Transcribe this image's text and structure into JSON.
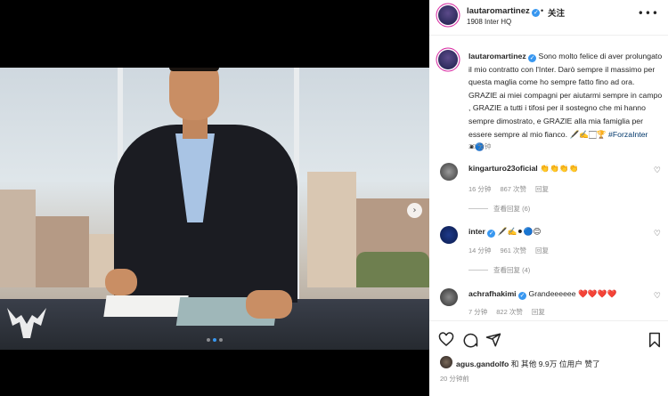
{
  "header": {
    "username": "lautaromartinez",
    "separator": "•",
    "follow_label": "关注",
    "location": "1908 Inter HQ",
    "more_icon": "ellipsis-icon"
  },
  "media": {
    "next_arrow": "›",
    "slide_count": 3,
    "active_slide": 2,
    "logo": "lm-bull-logo"
  },
  "caption": {
    "username": "lautaromartinez",
    "text": "Sono molto felice di aver prolungato il mio contratto con l'Inter. Darò sempre il massimo per questa maglia come ho sempre fatto fino ad ora. GRAZIE ai miei compagni per aiutarmi sempre in campo , GRAZIE a tutti i tifosi per il sostegno che mi hanno sempre dimostrato, e GRAZIE alla mia famiglia per essere sempre al mio fianco. 🖋️✍️🏻🏆",
    "hashtag": "#ForzaInter",
    "emoji_tail": "⚫🔵",
    "time": "20 分钟"
  },
  "comments": [
    {
      "username": "kingarturo23oficial",
      "text": "👏👏👏👏",
      "time": "16 分钟",
      "likes": "867 次赞",
      "reply_label": "回复",
      "view_replies": "查看回复 (6)"
    },
    {
      "username": "inter",
      "text": "🖋️✍️⚫🔵😊",
      "time": "14 分钟",
      "likes": "961 次赞",
      "reply_label": "回复",
      "view_replies": "查看回复 (4)"
    },
    {
      "username": "achrafhakimi",
      "text": "Grandeeeeee ❤️❤️❤️❤️",
      "time": "7 分钟",
      "likes": "822 次赞",
      "reply_label": "回复"
    }
  ],
  "actions": {
    "like_icon": "heart-icon",
    "comment_icon": "comment-icon",
    "share_icon": "share-icon",
    "save_icon": "bookmark-icon"
  },
  "likes_summary": {
    "user": "agus.gandolfo",
    "rest": " 和 其他 9.9万 位用户 赞了",
    "time": "20 分钟前"
  },
  "colors": {
    "verified_blue": "#3897f0",
    "hashtag_blue": "#00376b",
    "muted_text": "#8e8e8e"
  }
}
